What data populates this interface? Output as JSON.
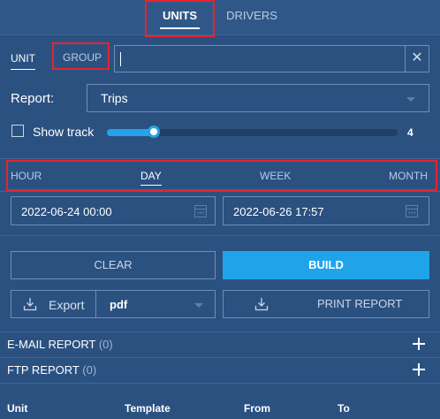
{
  "top_tabs": {
    "units": "UNITS",
    "drivers": "DRIVERS"
  },
  "unit_group": {
    "unit": "UNIT",
    "group": "GROUP",
    "search_value": ""
  },
  "report": {
    "label": "Report:",
    "selected": "Trips"
  },
  "show_track": {
    "label": "Show track",
    "checked": false,
    "value": "4",
    "level_fraction": 0.16
  },
  "period": {
    "hour": "HOUR",
    "day": "DAY",
    "week": "WEEK",
    "month": "MONTH",
    "active": "DAY"
  },
  "dates": {
    "from": "2022-06-24 00:00",
    "to": "2022-06-26 17:57"
  },
  "buttons": {
    "clear": "CLEAR",
    "build": "BUILD",
    "export": "Export",
    "format": "pdf",
    "print": "PRINT REPORT"
  },
  "sections": {
    "email": {
      "title": "E-MAIL REPORT",
      "count": "(0)"
    },
    "ftp": {
      "title": "FTP REPORT",
      "count": "(0)"
    }
  },
  "table": {
    "columns": [
      "Unit",
      "Template",
      "From",
      "To"
    ]
  },
  "colors": {
    "background": "#2b5181",
    "accent": "#1fa4ea",
    "highlight": "#e8232e"
  }
}
